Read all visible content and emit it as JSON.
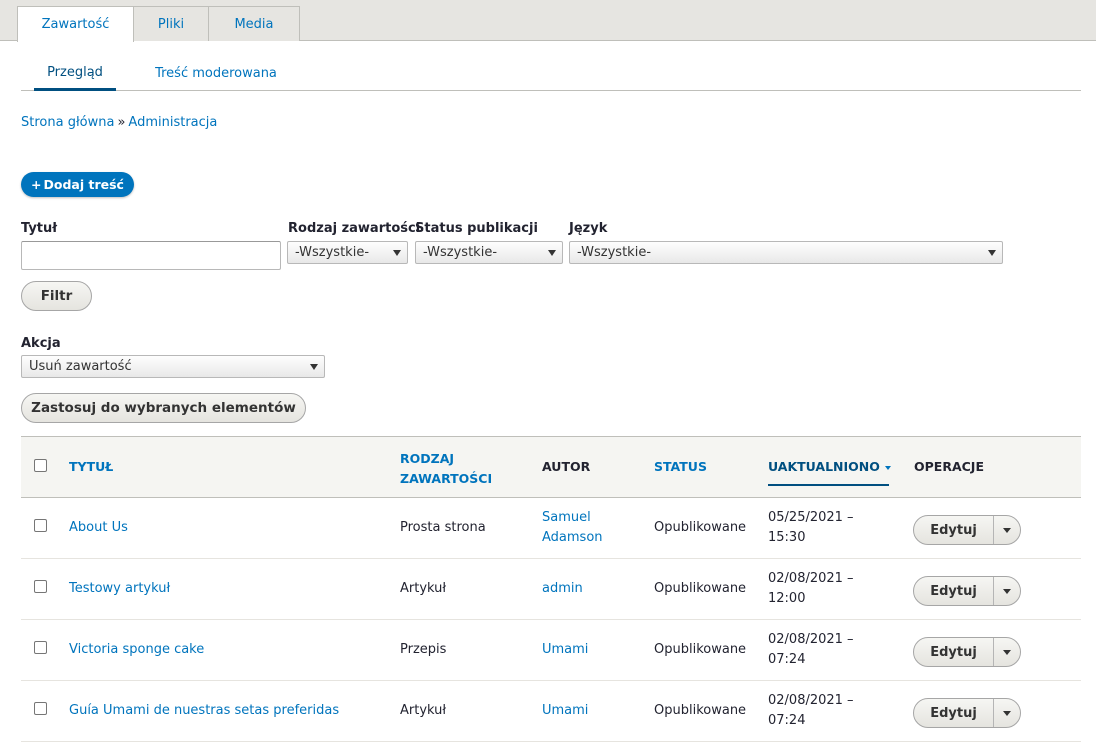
{
  "tabs_primary": [
    "Zawartość",
    "Pliki",
    "Media"
  ],
  "tabs_secondary": [
    "Przegląd",
    "Treść moderowana"
  ],
  "breadcrumb": {
    "home": "Strona główna",
    "sep": "»",
    "admin": "Administracja"
  },
  "add_button": {
    "plus": "+",
    "label": "Dodaj treść"
  },
  "filters": {
    "title_label": "Tytuł",
    "title_value": "",
    "type_label": "Rodzaj zawartości",
    "type_value": "-Wszystkie-",
    "status_label": "Status publikacji",
    "status_value": "-Wszystkie-",
    "lang_label": "Język",
    "lang_value": "-Wszystkie-",
    "filter_button": "Filtr"
  },
  "action": {
    "label": "Akcja",
    "value": "Usuń zawartość",
    "apply_button": "Zastosuj do wybranych elementów"
  },
  "table": {
    "headers": {
      "title": "TYTUŁ",
      "type_line1": "RODZAJ",
      "type_line2": "ZAWARTOŚCI",
      "author": "AUTOR",
      "status": "STATUS",
      "updated": "UAKTUALNIONO",
      "operations": "OPERACJE"
    },
    "rows": [
      {
        "title": "About Us",
        "type": "Prosta strona",
        "author_l1": "Samuel",
        "author_l2": "Adamson",
        "status": "Opublikowane",
        "date": "05/25/2021 –",
        "time": "15:30",
        "op": "Edytuj"
      },
      {
        "title": "Testowy artykuł",
        "type": "Artykuł",
        "author_l1": "admin",
        "author_l2": "",
        "status": "Opublikowane",
        "date": "02/08/2021 –",
        "time": "12:00",
        "op": "Edytuj"
      },
      {
        "title": "Victoria sponge cake",
        "type": "Przepis",
        "author_l1": "Umami",
        "author_l2": "",
        "status": "Opublikowane",
        "date": "02/08/2021 –",
        "time": "07:24",
        "op": "Edytuj"
      },
      {
        "title": "Guía Umami de nuestras setas preferidas",
        "type": "Artykuł",
        "author_l1": "Umami",
        "author_l2": "",
        "status": "Opublikowane",
        "date": "02/08/2021 –",
        "time": "07:24",
        "op": "Edytuj"
      }
    ]
  },
  "colors": {
    "link": "#0074bd",
    "primary_button": "#0074bd",
    "active_tab_underline": "#004f80"
  }
}
